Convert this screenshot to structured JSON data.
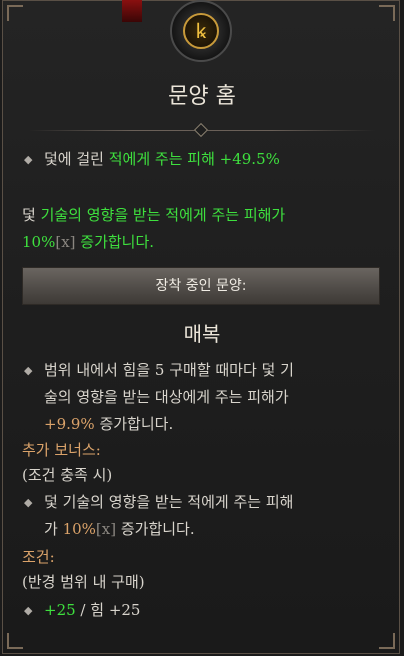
{
  "header": {
    "title": "문양 홈",
    "emblem_glyph": "ꝃ",
    "emblem_icon": "rune-emblem-icon"
  },
  "effect1": {
    "prefix": "덫에 걸린 ",
    "highlight": "적에게 주는 피해 +49.5%"
  },
  "effect2": {
    "line1_prefix": "덫 ",
    "line1_highlight": "기술의 영향을 받는 적에게 주는 피해가",
    "line2_value": "10%",
    "line2_bracket": "[x]",
    "line2_suffix": " 증가합니다."
  },
  "banner": {
    "label": "장착 중인 문양:"
  },
  "rare_node": {
    "name": "매복",
    "desc_line1": "범위 내에서 힘을 5 구매할 때마다 덫 기",
    "desc_line2": "술의 영향을 받는 대상에게 주는 피해가",
    "desc_line3_value": "+9.9%",
    "desc_line3_suffix": " 증가합니다."
  },
  "bonus": {
    "heading": "추가 보너스:",
    "condition": "(조건 충족 시)",
    "line1_prefix": "덫 ",
    "line1_rest": "기술의 영향을 받는 적에게 주는 피해",
    "line2_prefix": "가 ",
    "line2_value": "10%",
    "line2_bracket": "[x]",
    "line2_suffix": " 증가합니다."
  },
  "requirement": {
    "heading": "조건:",
    "detail": "(반경 범위 내 구매)",
    "current": "+25",
    "separator": " / ",
    "label": "힘 +25"
  },
  "colors": {
    "green": "#3ee03e",
    "orange": "#dba36a",
    "gray": "#8a8680"
  }
}
